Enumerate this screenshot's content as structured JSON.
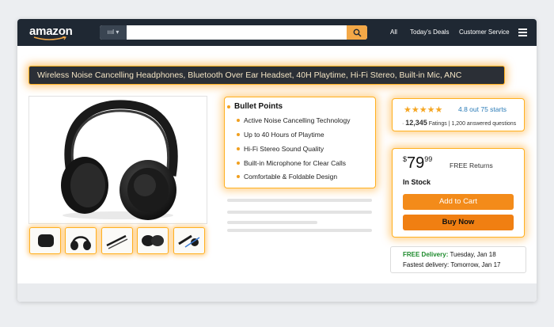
{
  "header": {
    "logo": "amazon",
    "search_category": "ıııl",
    "search_placeholder": "",
    "nav_all": "All",
    "nav_deals": "Today's Deals",
    "nav_service": "Customer Service"
  },
  "product": {
    "title": "Wireless Noise Cancelling Headphones, Bluetooth Over Ear Headset, 40H Playtime, Hi-Fi Stereo, Built-in Mic, ANC",
    "bullets_title": "Bullet Points",
    "bullets": [
      "Active Noise Cancelling Technology",
      "Up to 40 Hours of Playtime",
      "Hi-Fi Stereo Sound Quality",
      "Built-in Microphone for Clear Calls",
      "Comfortable & Foldable Design"
    ]
  },
  "rating": {
    "stars": "★★★★★",
    "text": "4.8 out 75 starts",
    "count": "12,345",
    "ratings_label": "Fatings",
    "answered": "1,200 answered questions",
    "value": 4.5
  },
  "buy": {
    "currency": "$",
    "price_whole": "79",
    "price_cents": "99",
    "free_returns": "FREE Returns",
    "stock": "In Stock",
    "add_to_cart": "Add to Cart",
    "buy_now": "Buy Now"
  },
  "delivery": {
    "free_label": "FREE Delivery:",
    "free_date": "Tuesday, Jan 18",
    "fastest_label": "Fastest delivery:",
    "fastest_date": "Tomorrow, Jan 17"
  },
  "colors": {
    "accent": "#f38b1a",
    "glow": "#ffb020",
    "topbar": "#1f2833",
    "link": "#2a7bb7",
    "green": "#1d8a2c"
  }
}
